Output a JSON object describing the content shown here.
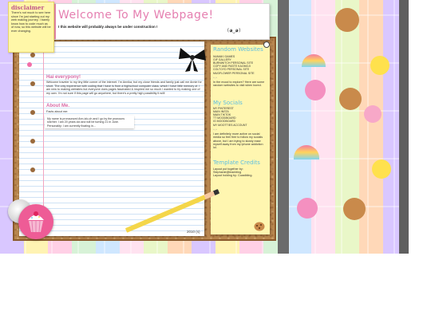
{
  "disclaimer": {
    "title": "disclaimer",
    "text": "There's not much to see here since I'm just starting out my web making journey. I barely know how to code much as of now, so this website will be ever changing."
  },
  "header": {
    "title": "Welcome To My Webpage!",
    "subtitle": "I this website will probably always be under construction !",
    "face": "(◕‿◕)"
  },
  "main": {
    "intro_heading": "Hai everypony!",
    "intro_text": "Welcome traveler to my tiny little corner of the internet. I'm Annika, but my close friends and family just call me Annie for short. The only experience with coding that I have is from a highschool computer class, which I have little memory of. I am new to making websites but everyone does pages fascinated & inspired me so much I wanted to try making one of my own. I'm not sure if this page will go anywhere, but there's a pretty high possibility it will!",
    "about_heading": "About Me.",
    "facts_label": "Facts about me:",
    "note_text": "My name is pronounced Ann-ick-uh and I go by the pronouns she/her. I am 20 years old and will be turning 21 in June. Personality: I am currently fixating in...",
    "date": "2010 (s)"
  },
  "sidebar": {
    "random_heading": "Random Websites",
    "random_links": [
      "NUMAKI GAMES",
      "GIF GALLERY",
      "BURNWITCH PERSONAL SITE",
      "COPY AND PASTE KAOMOJI",
      "COLTOYD PERSONAL SITE",
      "MUDFLOWER PERSONAL SITE"
    ],
    "sep1": "^.^",
    "explore_text": "In the mood to explore? Here are some random websites to visit when bored.",
    "socials_heading": "My Socials",
    "social_links": [
      "MY PINTEREST",
      "MAIN INSTA",
      "MAIN TIKTOK",
      "TT MOODBOARD",
      "IG MOODBOARD",
      "MY MOOTTIES ACCOUNT"
    ],
    "sep2": "^.^",
    "socials_text": "I am definitely more active on social media so feel free to follow my socials above, but I am trying to slowly ease myself away from my iphone addiction lol.",
    "credits_heading": "Template Credits",
    "credits_line1": "Layout put together by: Stephanie@ieanbling",
    "credits_line2": "Layout holding by: Coastbling."
  },
  "colors": {
    "pink": "#e57fb0",
    "heading_pink": "#d86ba6",
    "blue": "#5dbfe0",
    "cork": "#b8864e",
    "sticky": "#fff6b0"
  }
}
